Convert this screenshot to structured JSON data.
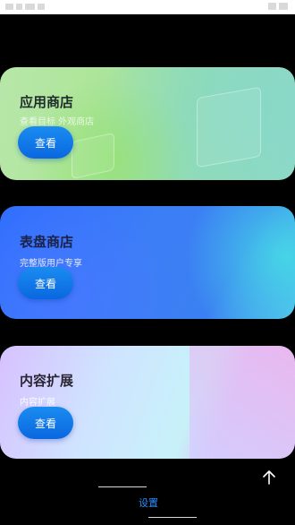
{
  "cards": [
    {
      "title": "应用商店",
      "subtitle": "查看目标 外观商店",
      "button": "查看"
    },
    {
      "title": "表盘商店",
      "subtitle": "完整版用户专享",
      "button": "查看"
    },
    {
      "title": "内容扩展",
      "subtitle": "内容扩展",
      "button": "查看"
    }
  ],
  "bottom_nav": {
    "settings_label": "设置"
  },
  "icons": {
    "scroll_top": "arrow-up-icon"
  },
  "colors": {
    "accent": "#2a8cff",
    "button": "#0f78e8",
    "background": "#000000"
  }
}
